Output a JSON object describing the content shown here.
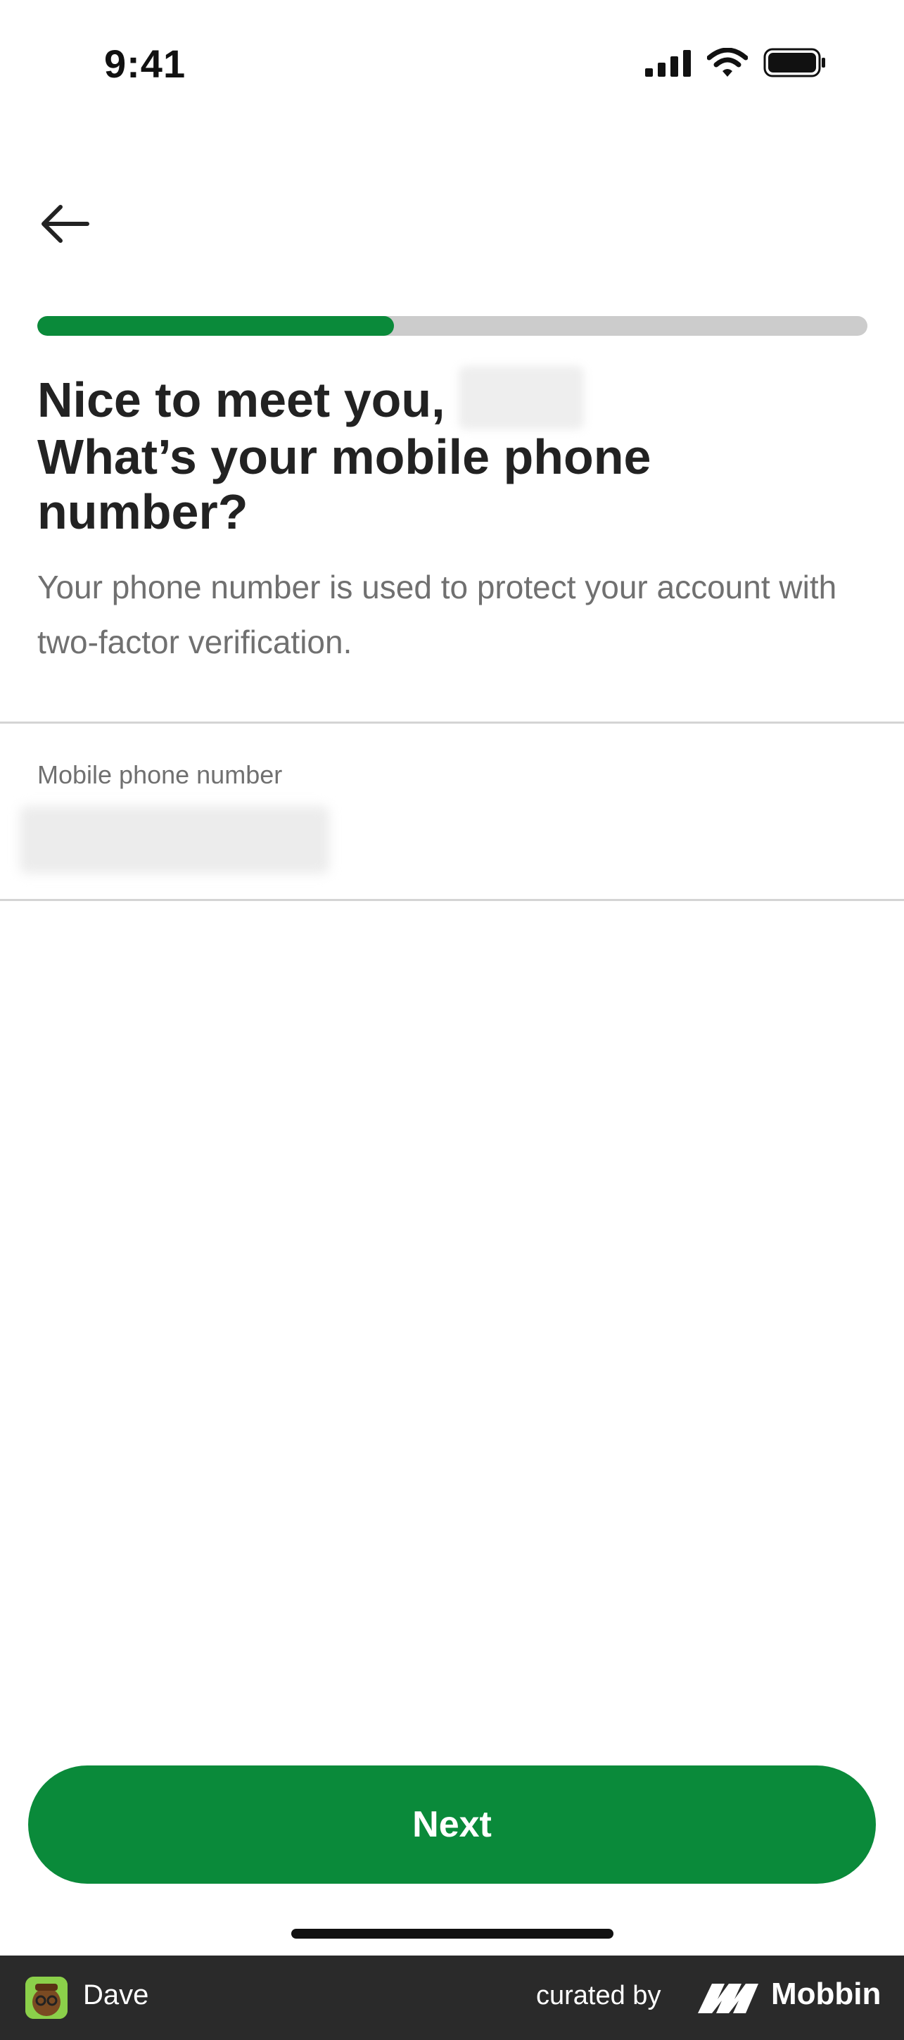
{
  "status_bar": {
    "time": "9:41"
  },
  "progress": {
    "fraction": 0.43,
    "fill_color": "#0a8a3a",
    "track_color": "#cccccc"
  },
  "header": {
    "greeting": "Nice to meet you,",
    "question": "What’s your mobile phone number?",
    "description": "Your phone number is used to protect your account with two-factor verification."
  },
  "phone_field": {
    "label": "Mobile phone number"
  },
  "actions": {
    "next_label": "Next"
  },
  "footer": {
    "app_name": "Dave",
    "curated_by": "curated by",
    "brand": "Mobbin"
  },
  "colors": {
    "accent": "#0a8a3a",
    "footer_bg": "#2a2a2a"
  },
  "icons": [
    "signal-icon",
    "wifi-icon",
    "battery-icon",
    "back-arrow-icon",
    "dave-logo-icon",
    "mobbin-logo-icon"
  ]
}
